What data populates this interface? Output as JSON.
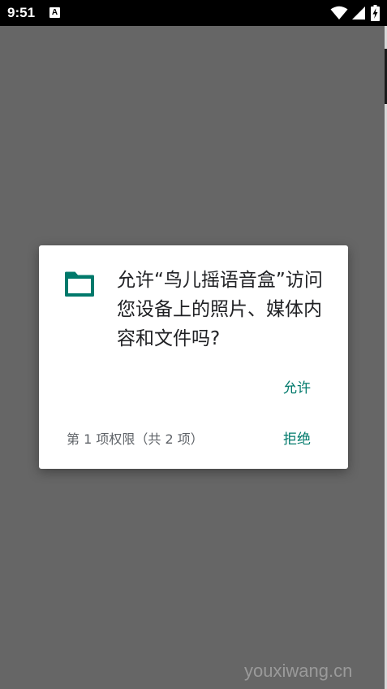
{
  "status_bar": {
    "time": "9:51",
    "notification_icon": "A",
    "icons": [
      "wifi-icon",
      "signal-icon",
      "battery-charging-icon"
    ]
  },
  "dialog": {
    "icon": "folder-icon",
    "message": "允许“鸟儿摇语音盒”访问您设备上的照片、媒体内容和文件吗?",
    "allow_label": "允许",
    "deny_label": "拒绝",
    "permission_counter": "第 1 项权限（共 2 项）"
  },
  "watermark": "youxiwang.cn",
  "colors": {
    "accent": "#00796b",
    "scrim": "#666666",
    "dialog_bg": "#ffffff",
    "status_bar": "#000000"
  }
}
